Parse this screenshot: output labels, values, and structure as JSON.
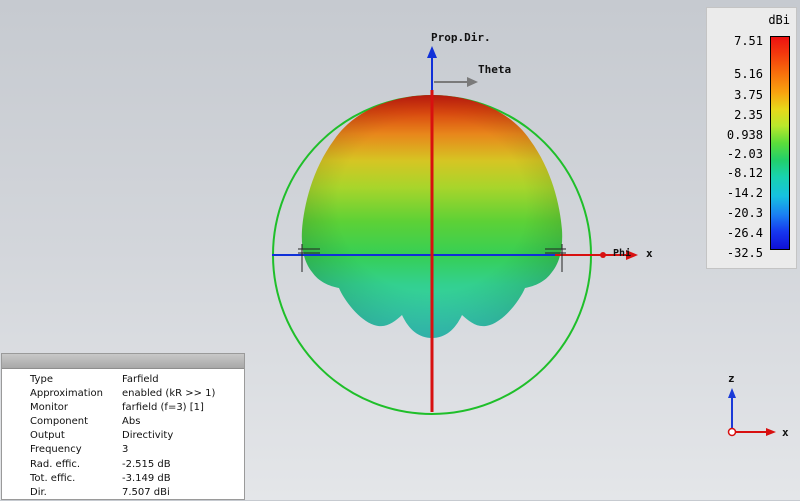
{
  "scene": {
    "prop_dir_label": "Prop.Dir.",
    "theta_label": "Theta",
    "phi_label": "Phi",
    "x_label": "x"
  },
  "legend": {
    "unit": "dBi",
    "ticks": [
      "7.51",
      "5.16",
      "3.75",
      "2.35",
      "0.938",
      "-2.03",
      "-8.12",
      "-14.2",
      "-20.3",
      "-26.4",
      "-32.5"
    ]
  },
  "info_panel": {
    "rows": [
      {
        "key": "Type",
        "value": "Farfield"
      },
      {
        "key": "Approximation",
        "value": "enabled (kR >> 1)"
      },
      {
        "key": "Monitor",
        "value": "farfield (f=3) [1]"
      },
      {
        "key": "Component",
        "value": "Abs"
      },
      {
        "key": "Output",
        "value": "Directivity"
      },
      {
        "key": "Frequency",
        "value": "3"
      },
      {
        "key": "Rad. effic.",
        "value": "-2.515 dB"
      },
      {
        "key": "Tot. effic.",
        "value": "-3.149 dB"
      },
      {
        "key": "Dir.",
        "value": "7.507 dBi"
      }
    ]
  },
  "triad": {
    "z_label": "z",
    "x_label": "x"
  }
}
